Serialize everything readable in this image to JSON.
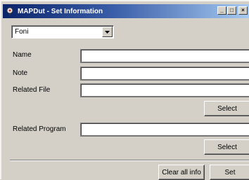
{
  "window": {
    "title": "MAPDut - Set Information",
    "app_icon": "map-pin-icon",
    "controls": {
      "minimize": "_",
      "maximize": "□",
      "close": "×"
    }
  },
  "combo": {
    "selected": "Foni",
    "arrow_icon": "chevron-down-icon"
  },
  "fields": {
    "name_label": "Name",
    "name_value": "",
    "note_label": "Note",
    "note_value": "",
    "related_file_label": "Related File",
    "related_file_value": "",
    "related_program_label": "Related Program",
    "related_program_value": ""
  },
  "buttons": {
    "select_file": "Select",
    "select_program": "Select",
    "clear_all": "Clear all info",
    "set": "Set"
  },
  "colors": {
    "title_gradient_start": "#0a246a",
    "title_gradient_end": "#a6caf0",
    "face": "#d4d0c8"
  }
}
